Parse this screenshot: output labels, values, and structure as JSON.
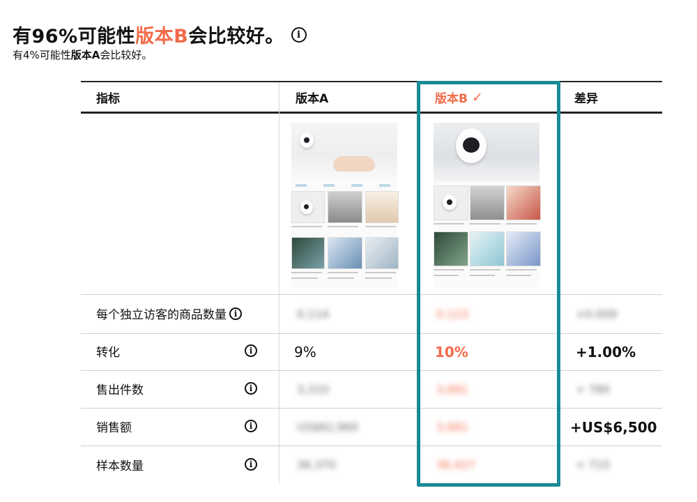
{
  "headline": {
    "prefix": "有96%可能性",
    "highlight": "版本B",
    "suffix": "会比较好。",
    "icon": "info-icon"
  },
  "subline": {
    "prefix": "有4%可能性",
    "bold": "版本A",
    "suffix": "会比较好。"
  },
  "table": {
    "headers": {
      "metric": "指标",
      "version_a": "版本A",
      "version_b": "版本B",
      "version_b_mark": "✓",
      "difference": "差异"
    },
    "rows": [
      {
        "label": "每个独立访客的商品数量",
        "a": "0.114",
        "b": "0.123",
        "diff": "+0.009",
        "blurred": true
      },
      {
        "label": "转化",
        "a": "9%",
        "b": "10%",
        "diff": "+1.00%",
        "blurred": false
      },
      {
        "label": "售出件数",
        "a": "3,310",
        "b": "3,681",
        "diff": "+ 780",
        "blurred": true
      },
      {
        "label": "销售额",
        "a": "US$62,960",
        "b": "3,681",
        "diff": "+US$6,500",
        "blurred": true,
        "diff_visible": true
      },
      {
        "label": "样本数量",
        "a": "36,370",
        "b": "36,427",
        "diff": "+ 715",
        "blurred": true
      }
    ]
  },
  "colors": {
    "accent": "#f26b4a",
    "highlight_border": "#1a8a97",
    "text": "#111111"
  }
}
